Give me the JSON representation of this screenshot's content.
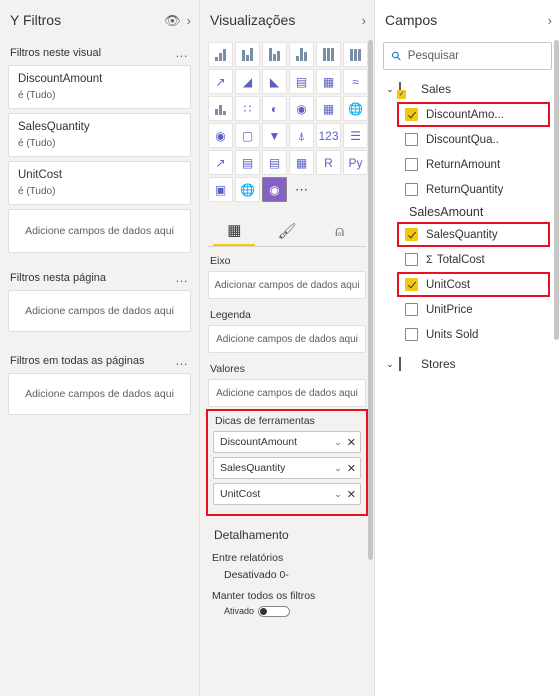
{
  "filters": {
    "title": "Y Filtros",
    "icons": {
      "eye": "eye-icon",
      "expand": "chevron-right-icon"
    },
    "sections": [
      {
        "label": "Filtros neste visual",
        "more": "…"
      },
      {
        "label": "Filtros nesta página",
        "more": "…"
      },
      {
        "label": "Filtros em todas as páginas",
        "more": "…"
      }
    ],
    "visual_filters": [
      {
        "name": "DiscountAmount",
        "state": "é (Tudo)"
      },
      {
        "name": "SalesQuantity",
        "state": "é (Tudo)"
      },
      {
        "name": "UnitCost",
        "state": "é (Tudo)"
      }
    ],
    "dropzone_visual": "Adicione campos de dados aqui",
    "dropzone_page": "Adicione campos de dados aqui",
    "dropzone_all": "Adicione campos de dados aqui"
  },
  "visualizations": {
    "title": "Visualizações",
    "expand_icon": "chevron-right-icon",
    "icon_rows": [
      [
        "stacked-bar-chart-icon",
        "clustered-bar-chart-icon",
        "stacked-column-chart-icon",
        "clustered-column-chart-icon",
        "100-stacked-bar-icon",
        "100-stacked-column-icon"
      ],
      [
        "line-chart-icon",
        "area-chart-icon",
        "stacked-area-chart-icon",
        "line-stacked-column-icon",
        "line-clustered-column-icon",
        "ribbon-chart-icon"
      ],
      [
        "waterfall-chart-icon",
        "scatter-chart-icon",
        "pie-chart-icon",
        "donut-chart-icon",
        "treemap-icon",
        "map-icon"
      ],
      [
        "filled-map-icon",
        "shape-map-icon",
        "funnel-icon",
        "gauge-icon",
        "card-icon",
        "multi-row-card-icon"
      ],
      [
        "kpi-icon",
        "slicer-icon",
        "table-icon",
        "matrix-icon",
        "r-script-icon",
        "python-visual-icon"
      ],
      [
        "key-influencers-icon",
        "decomposition-tree-icon",
        "qa-visual-icon",
        "smart-narrative-icon",
        "paginated-report-icon",
        "more-options-icon"
      ]
    ],
    "tabs": [
      {
        "name": "fields-tab",
        "glyph": "▦",
        "active": true
      },
      {
        "name": "format-tab",
        "glyph": "⌦",
        "active": false
      },
      {
        "name": "analytics-tab",
        "glyph": "◍",
        "active": false
      }
    ],
    "wells": [
      {
        "label": "Eixo",
        "placeholder": "Adicionar campos de dados aqui"
      },
      {
        "label": "Legenda",
        "placeholder": "Adicione campos de dados aqui"
      },
      {
        "label": "Valores",
        "placeholder": "Adicione campos de dados aqui"
      }
    ],
    "tooltip_well": {
      "label": "Dicas de ferramentas",
      "highlighted": true,
      "fields": [
        {
          "name": "DiscountAmount",
          "chevron": "⌄",
          "close": "✕"
        },
        {
          "name": "SalesQuantity",
          "chevron": "⌄",
          "close": "✕"
        },
        {
          "name": "UnitCost",
          "chevron": "⌄",
          "close": "✕"
        }
      ]
    },
    "drill": {
      "title": "Detalhamento",
      "cross_report_label": "Entre relatórios",
      "cross_report_value": "Desativado 0-",
      "keep_filters_label": "Manter todos os filtros",
      "keep_filters_value": "Ativado"
    }
  },
  "fields": {
    "title": "Campos",
    "expand_icon": "chevron-right-icon",
    "search_placeholder": "Pesquisar",
    "tables": [
      {
        "name": "Sales",
        "expanded": true,
        "chevron": "⌄",
        "items": [
          {
            "label": "DiscountAmo...",
            "checked": true,
            "highlighted": true,
            "measure": false
          },
          {
            "label": "DiscountQua..",
            "checked": false,
            "highlighted": false,
            "measure": false
          },
          {
            "label": "ReturnAmount",
            "checked": false,
            "highlighted": false,
            "measure": false
          },
          {
            "label": "ReturnQuantity",
            "checked": false,
            "highlighted": false,
            "measure": false
          },
          {
            "label": "SalesAmount",
            "checked": false,
            "highlighted": false,
            "measure": false,
            "group_header": true
          },
          {
            "label": "SalesQuantity",
            "checked": true,
            "highlighted": true,
            "measure": false
          },
          {
            "label": "TotalCost",
            "checked": false,
            "highlighted": false,
            "measure": true
          },
          {
            "label": "UnitCost",
            "checked": true,
            "highlighted": true,
            "measure": false
          },
          {
            "label": "UnitPrice",
            "checked": false,
            "highlighted": false,
            "measure": false
          },
          {
            "label": "Units Sold",
            "checked": false,
            "highlighted": false,
            "measure": false
          }
        ]
      },
      {
        "name": "Stores",
        "expanded": false,
        "chevron": "⌄",
        "items": []
      }
    ]
  },
  "colors": {
    "highlight_red": "#e81123",
    "checkbox_yellow": "#f2c811",
    "accent_blue": "#0078d4",
    "pane_bg": "#f3f2f1"
  }
}
